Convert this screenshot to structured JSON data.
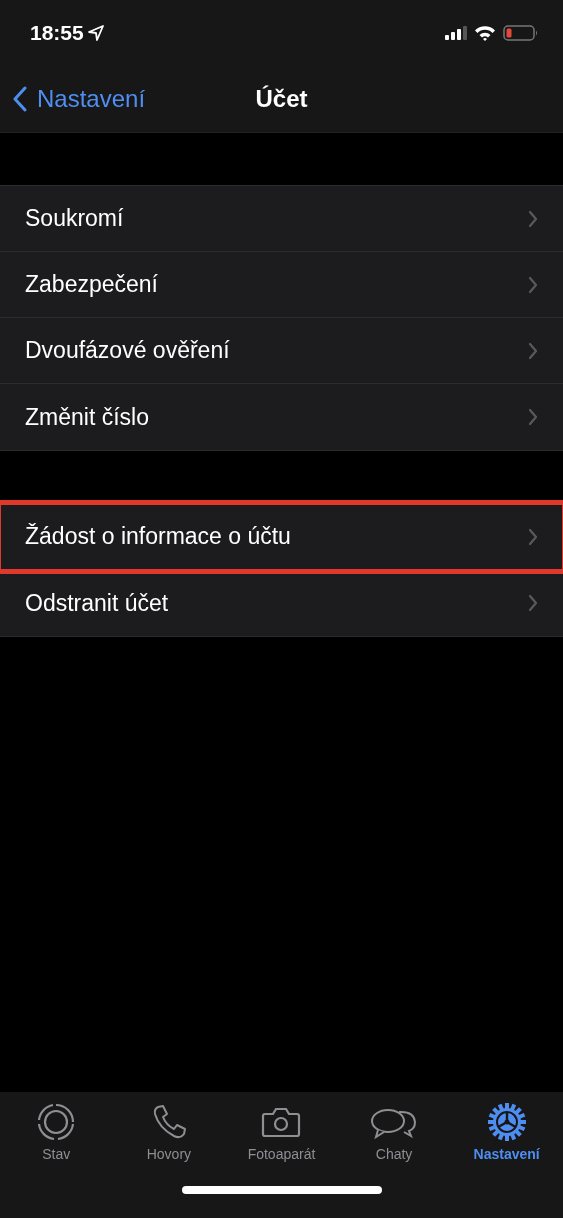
{
  "status_bar": {
    "time": "18:55"
  },
  "nav_bar": {
    "back": "Nastavení",
    "title": "Účet"
  },
  "groups": [
    {
      "rows": [
        {
          "label": "Soukromí",
          "highlighted": false
        },
        {
          "label": "Zabezpečení",
          "highlighted": false
        },
        {
          "label": "Dvoufázové ověření",
          "highlighted": false
        },
        {
          "label": "Změnit číslo",
          "highlighted": false
        }
      ]
    },
    {
      "rows": [
        {
          "label": "Žádost o informace o účtu",
          "highlighted": true
        },
        {
          "label": "Odstranit účet",
          "highlighted": false
        }
      ]
    }
  ],
  "tab_bar": [
    {
      "label": "Stav",
      "kind": "status",
      "selected": false
    },
    {
      "label": "Hovory",
      "kind": "calls",
      "selected": false
    },
    {
      "label": "Fotoaparát",
      "kind": "camera",
      "selected": false
    },
    {
      "label": "Chaty",
      "kind": "chats",
      "selected": false
    },
    {
      "label": "Nastavení",
      "kind": "settings",
      "selected": true
    }
  ]
}
